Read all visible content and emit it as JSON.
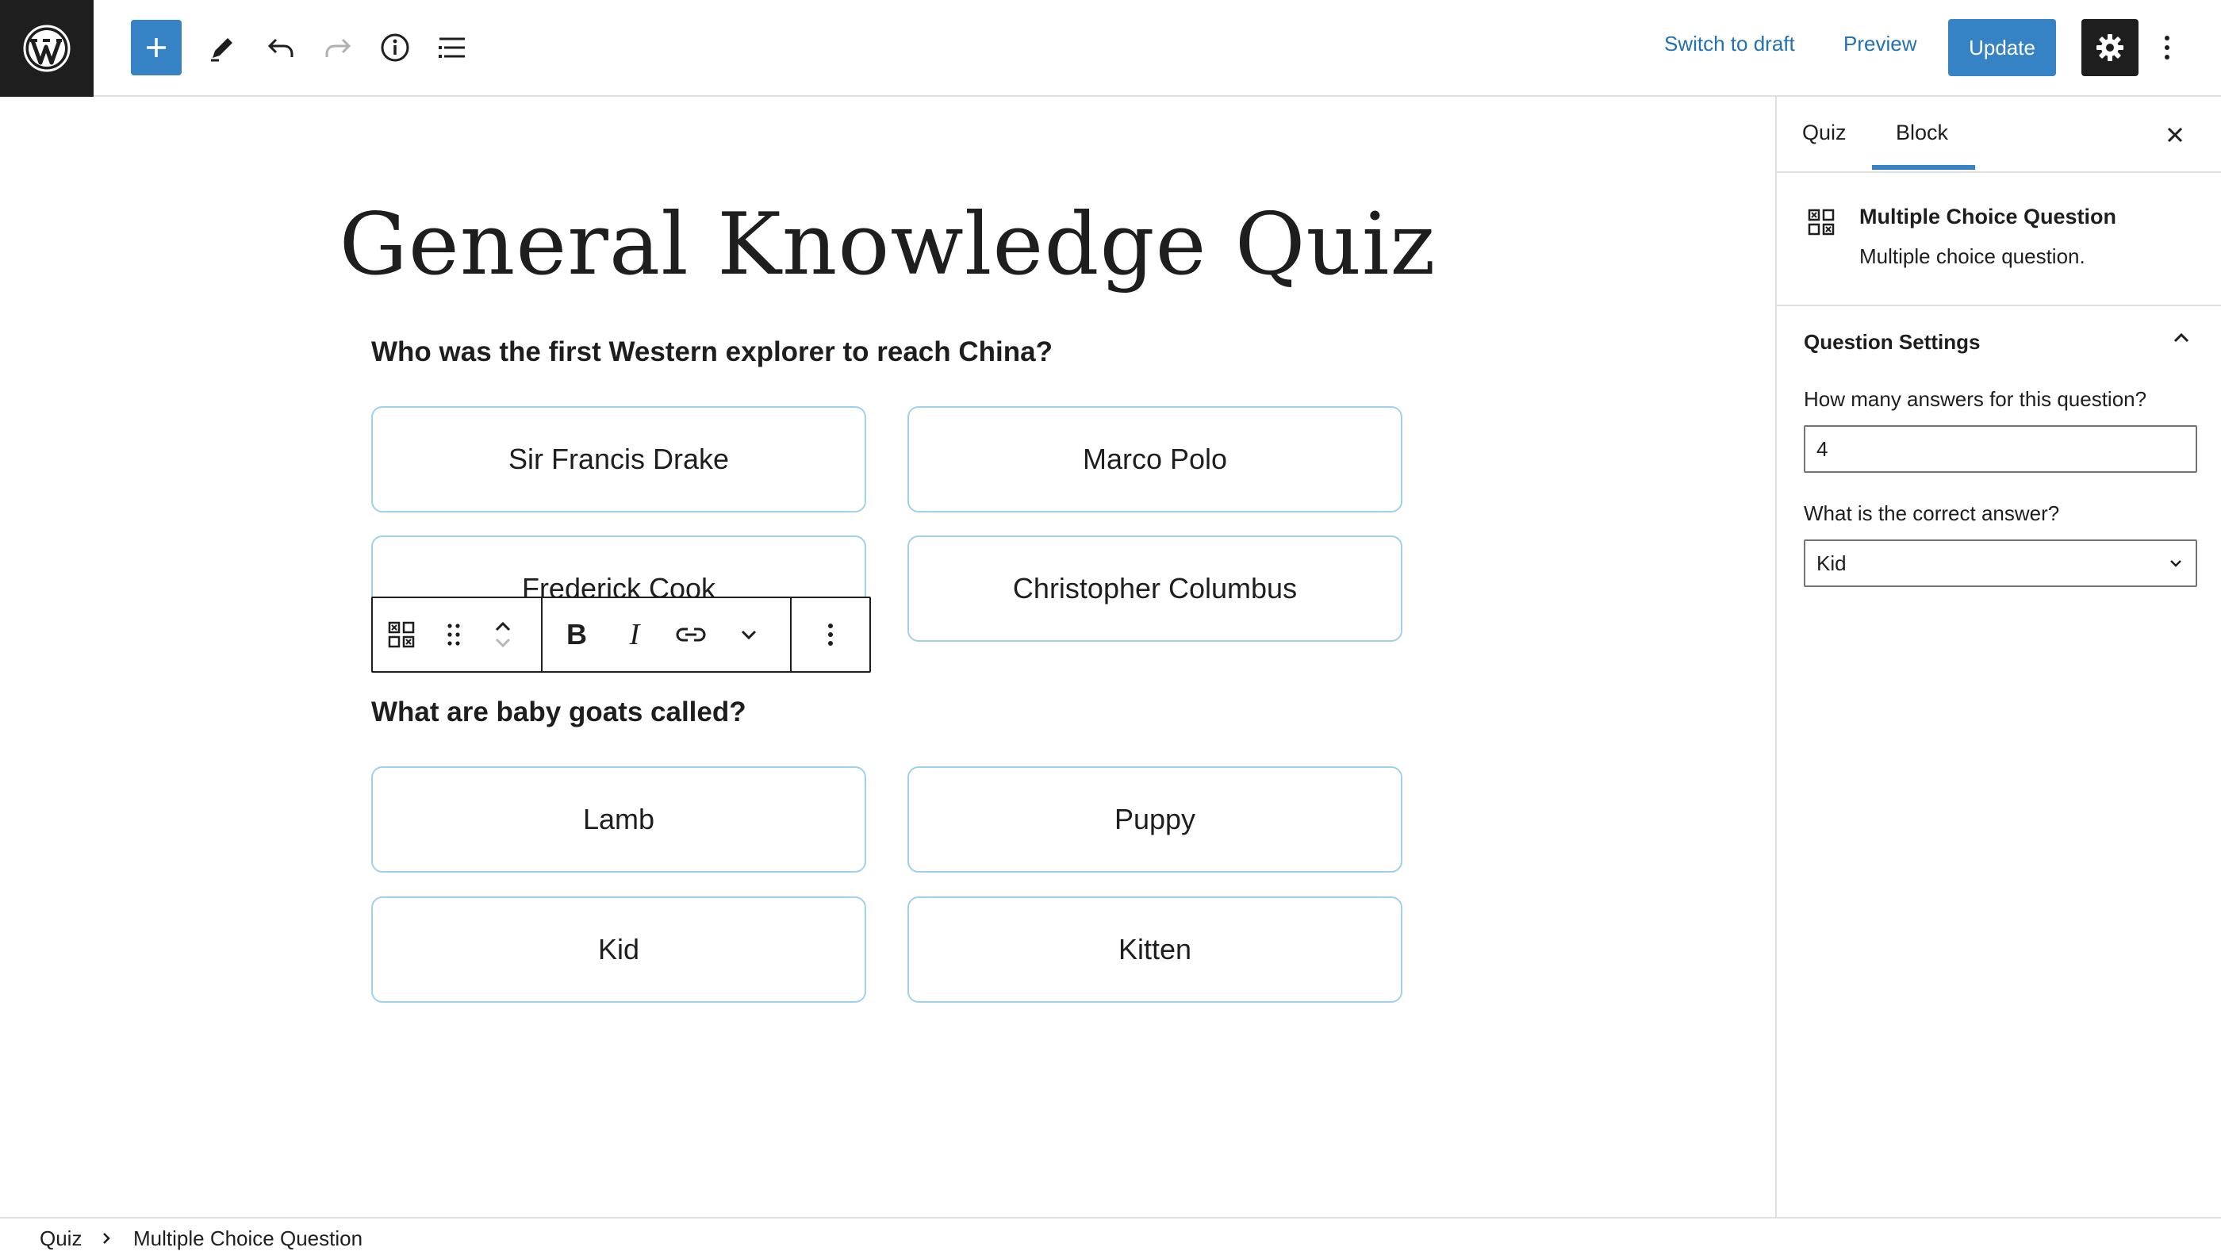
{
  "toolbar": {
    "switch_to_draft": "Switch to draft",
    "preview": "Preview",
    "update": "Update",
    "icons": [
      "wordpress-logo",
      "plus-icon",
      "pencil-icon",
      "undo-icon",
      "redo-icon",
      "info-icon",
      "list-view-icon",
      "gear-icon",
      "more-vertical-icon"
    ]
  },
  "content": {
    "title": "General Knowledge Quiz",
    "questions": [
      {
        "text": "Who was the first Western explorer to reach China?",
        "answers": [
          "Sir Francis Drake",
          "Marco Polo",
          "Frederick Cook",
          "Christopher Columbus"
        ]
      },
      {
        "text": "What are baby goats called?",
        "answers": [
          "Lamb",
          "Puppy",
          "Kid",
          "Kitten"
        ]
      }
    ]
  },
  "sidebar": {
    "tabs": [
      "Quiz",
      "Block"
    ],
    "active_tab": "Block",
    "block_name": "Multiple Choice Question",
    "block_description": "Multiple choice question.",
    "panel_title": "Question Settings",
    "answers_count_label": "How many answers for this question?",
    "answers_count_value": "4",
    "correct_answer_label": "What is the correct answer?",
    "correct_answer_value": "Kid"
  },
  "breadcrumb": {
    "items": [
      "Quiz",
      "Multiple Choice Question"
    ]
  },
  "colors": {
    "accent": "#3582c4",
    "link": "#2271b1",
    "dark": "#1e1e1e",
    "answer_border": "#9fd0ec"
  }
}
